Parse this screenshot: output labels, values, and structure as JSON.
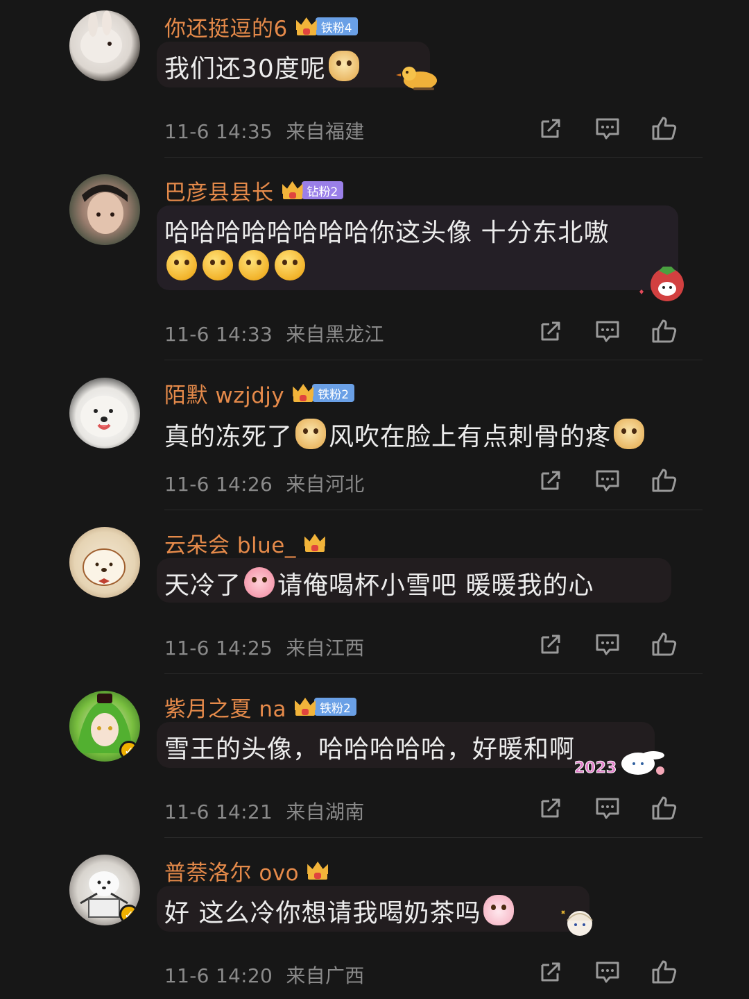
{
  "comments": [
    {
      "username": "你还挺逗的6",
      "badge": "铁粉4",
      "badge_type": "iron",
      "text_parts": [
        "我们还30度呢"
      ],
      "time": "11-6 14:35",
      "location": "来自福建",
      "verified": false
    },
    {
      "username": "巴彦县县长",
      "badge": "钻粉2",
      "badge_type": "diamond",
      "text_parts": [
        "哈哈哈哈哈哈哈哈你这头像 十分东北嗷"
      ],
      "time": "11-6 14:33",
      "location": "来自黑龙江",
      "verified": false
    },
    {
      "username": "陌默 wzjdjy",
      "badge": "铁粉2",
      "badge_type": "iron",
      "text_parts": [
        "真的冻死了",
        "风吹在脸上有点刺骨的疼"
      ],
      "time": "11-6 14:26",
      "location": "来自河北",
      "verified": false
    },
    {
      "username": "云朵会 blue_",
      "badge": "",
      "badge_type": "none",
      "text_parts": [
        "天冷了",
        "请俺喝杯小雪吧 暖暖我的心"
      ],
      "time": "11-6 14:25",
      "location": "来自江西",
      "verified": false
    },
    {
      "username": "紫月之夏 na",
      "badge": "铁粉2",
      "badge_type": "iron",
      "text_parts": [
        "雪王的头像，哈哈哈哈哈，好暖和啊"
      ],
      "sticker_text": "2023",
      "time": "11-6 14:21",
      "location": "来自湖南",
      "verified": true
    },
    {
      "username": "普萘洛尔 ovo",
      "badge": "",
      "badge_type": "none",
      "text_parts": [
        "好 这么冷你想请我喝奶茶吗"
      ],
      "time": "11-6 14:20",
      "location": "来自广西",
      "verified": true
    }
  ],
  "colors": {
    "background": "#171717",
    "username": "#e58a4a",
    "meta": "#8a8a8a",
    "iron_badge": "#6aa0e6",
    "diamond_badge": "#9a7fe8",
    "verify": "#f0b000"
  },
  "icons": [
    "share-icon",
    "comment-icon",
    "like-icon",
    "crown-icon",
    "verified-icon"
  ]
}
